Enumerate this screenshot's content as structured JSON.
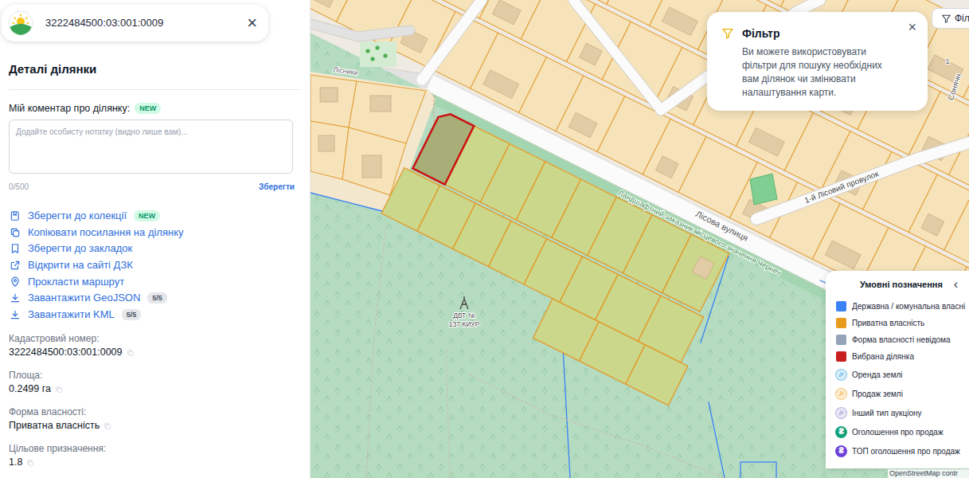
{
  "search": {
    "value": "3222484500:03:001:0009",
    "close": "×"
  },
  "panel": {
    "title": "Деталі ділянки"
  },
  "comment": {
    "label": "Мій коментар про ділянку:",
    "badge": {
      "text": "NEW",
      "kind": "new"
    },
    "placeholder": "Додайте особисту нотатку (видно лише вам)...",
    "counter": "0/500",
    "save": "Зберегти"
  },
  "actions": [
    {
      "label": "Зберегти до колекції",
      "badge": {
        "text": "NEW",
        "kind": "new"
      }
    },
    {
      "label": "Копіювати посилання на ділянку"
    },
    {
      "label": "Зберегти до закладок"
    },
    {
      "label": "Відкрити на сайті ДЗК"
    },
    {
      "label": "Прокласти маршрут"
    },
    {
      "label": "Завантажити GeoJSON",
      "badge": {
        "text": "5/5",
        "kind": "count"
      }
    },
    {
      "label": "Завантажити KML",
      "badge": {
        "text": "5/5",
        "kind": "count"
      }
    }
  ],
  "fields": [
    {
      "label": "Кадастровий номер:",
      "value": "3222484500:03:001:0009"
    },
    {
      "label": "Площа:",
      "value": "0.2499 га"
    },
    {
      "label": "Форма власності:",
      "value": "Приватна власність"
    },
    {
      "label": "Цільове призначення:",
      "value": "1.8"
    }
  ],
  "map": {
    "parcels": [
      {
        "selected": true
      },
      {
        "selected": false
      },
      {
        "selected": false
      },
      {
        "selected": false
      },
      {
        "selected": false
      },
      {
        "selected": false
      },
      {
        "selected": false
      },
      {
        "selected": false
      },
      {
        "selected": false
      },
      {
        "selected": false
      },
      {
        "selected": false
      },
      {
        "selected": false
      },
      {
        "selected": false
      },
      {
        "selected": false
      },
      {
        "selected": false
      },
      {
        "selected": false
      },
      {
        "selected": false
      },
      {
        "selected": false
      },
      {
        "selected": false
      }
    ],
    "labels": [
      {
        "text": "Лісники"
      },
      {
        "text": "ДВТ №"
      },
      {
        "text": "137 КИУР"
      },
      {
        "text": "Лісова вулиця"
      },
      {
        "text": "1-й Лісовий провулок"
      },
      {
        "text": "Ландшафтний заказник місцевого значення Чернеч"
      },
      {
        "text": "Сонячн"
      },
      {
        "text": "1"
      }
    ]
  },
  "filter_tip": {
    "title": "Фільтр",
    "text": "Ви можете використовувати фільтри для пошуку необхідних вам ділянок чи змінювати налаштування карти.",
    "close": "×"
  },
  "filter_button": {
    "label": "Філ"
  },
  "legend": {
    "title": "Умовні позначення",
    "collapse": "‹",
    "items": [
      {
        "label": "Державна / комунальна власні",
        "kind": "square",
        "color": "#3b82f6"
      },
      {
        "label": "Приватна власність",
        "kind": "square",
        "color": "#e89b1c"
      },
      {
        "label": "Форма власності невідома",
        "kind": "square",
        "color": "#94a3b8"
      },
      {
        "label": "Вибрана ділянка",
        "kind": "square",
        "color": "#c81e1e"
      },
      {
        "label": "Оренда землі",
        "kind": "auction",
        "color": "#3ba3e0"
      },
      {
        "label": "Продаж землі",
        "kind": "auction",
        "color": "#f5a623"
      },
      {
        "label": "Інший тип аукціону",
        "kind": "auction",
        "color": "#8b86cf"
      },
      {
        "label": "Оголошення про продаж",
        "kind": "sale",
        "color": "#12a37a",
        "glyph": "₴"
      },
      {
        "label": "ТОП оголошення про продаж",
        "kind": "sale",
        "color": "#6d3fd9",
        "glyph": "₴"
      }
    ]
  },
  "attribution": "OpenStreetMap contr"
}
